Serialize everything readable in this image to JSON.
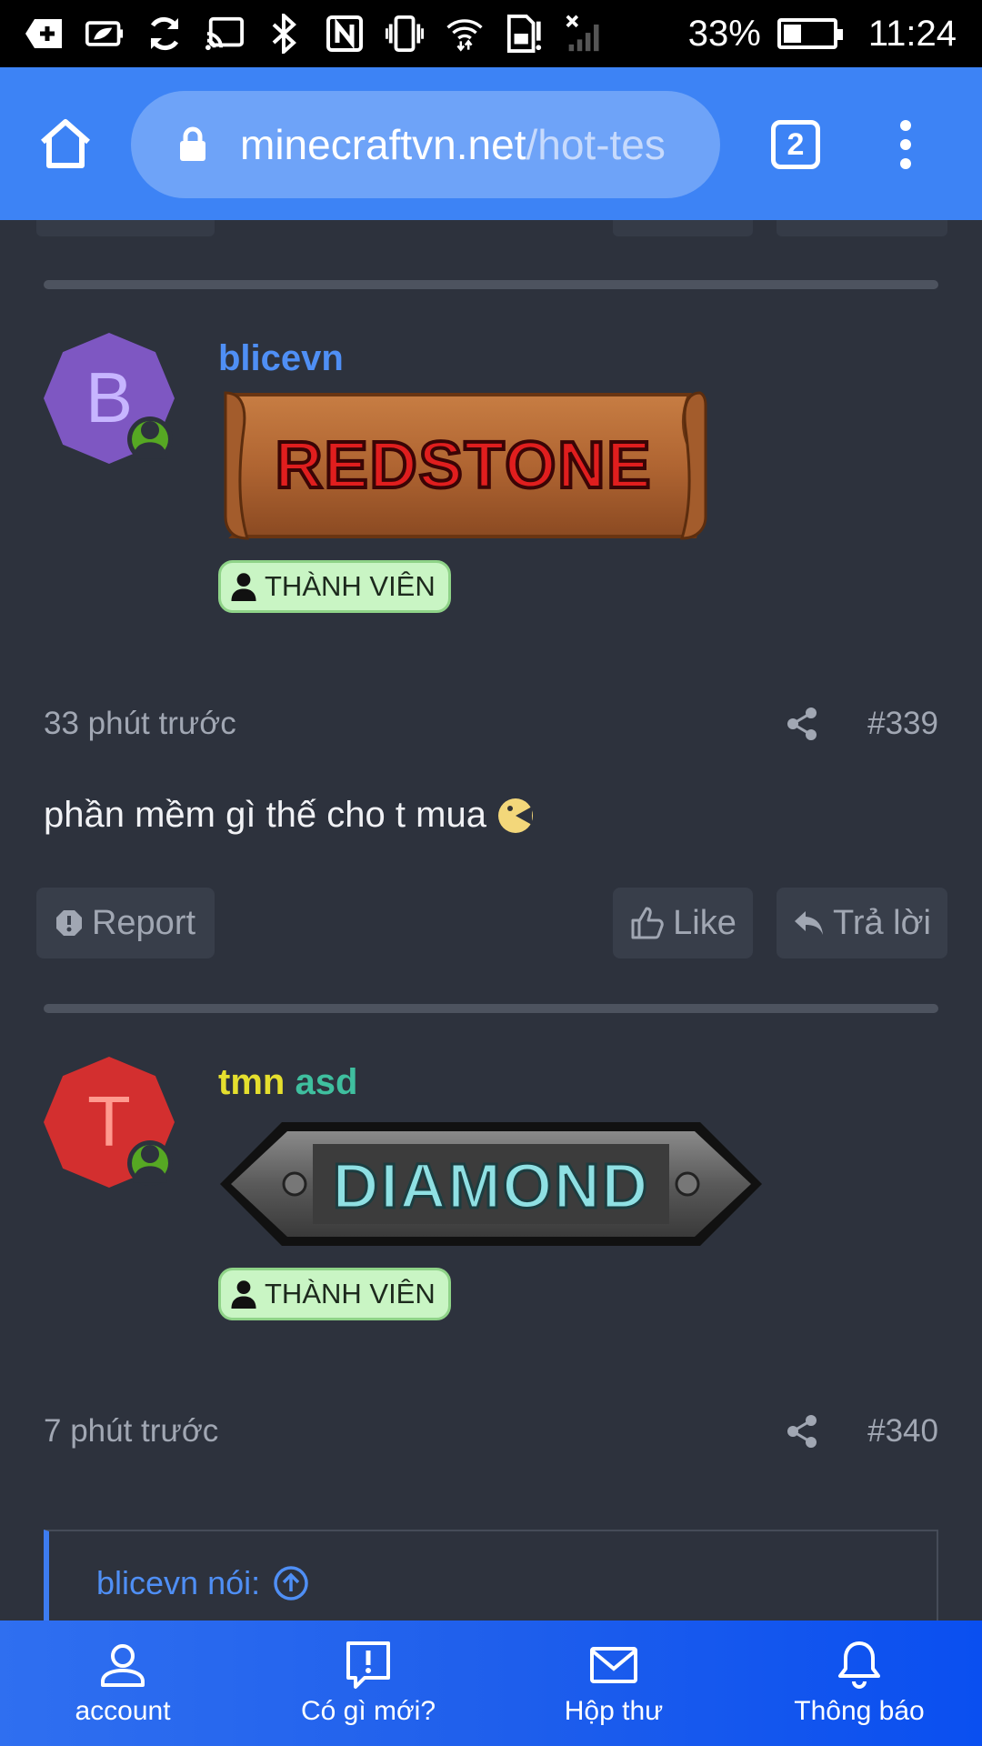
{
  "status_bar": {
    "battery": "33%",
    "time": "11:24",
    "battery_level": 0.33,
    "icons": [
      "add-icon",
      "battery-saver-icon",
      "sync-icon",
      "cast-icon",
      "bluetooth-icon",
      "nfc-icon",
      "vibrate-icon",
      "wifi-icon",
      "sim-alert-icon",
      "no-signal-icon"
    ]
  },
  "browser": {
    "url_host": "minecraftvn.net",
    "url_path": "/hot-tes",
    "tab_count": "2",
    "icons": [
      "home-icon",
      "lock-icon",
      "menu-icon"
    ]
  },
  "posts": [
    {
      "avatar_letter": "B",
      "avatar_color": "#7e57c2",
      "username": "blicevn",
      "username_color": "#4f8ff5",
      "rank_banner": "REDSTONE",
      "role_badge": "THÀNH VIÊN",
      "time": "33 phút trước",
      "number": "#339",
      "text": "phần mềm gì thế cho t mua",
      "actions": {
        "report": "Report",
        "like": "Like",
        "reply": "Trả lời"
      }
    },
    {
      "avatar_letter": "T",
      "avatar_color": "#d32f2f",
      "username_part1": "tmn",
      "username_part2": "asd",
      "username_colors": [
        "#e5df2e",
        "#3fbf9f"
      ],
      "rank_banner": "DIAMOND",
      "role_badge": "THÀNH VIÊN",
      "time": "7 phút trước",
      "number": "#340",
      "quote_author": "blicevn nói:"
    }
  ],
  "bottom_nav": [
    {
      "label": "account",
      "icon": "account-icon"
    },
    {
      "label": "Có gì mới?",
      "icon": "whats-new-icon"
    },
    {
      "label": "Hộp thư",
      "icon": "inbox-icon"
    },
    {
      "label": "Thông báo",
      "icon": "bell-icon"
    }
  ],
  "colors": {
    "toolbar": "#3d83f5",
    "background": "#2d323d",
    "accent": "#4f8ff5",
    "online": "#56a823"
  }
}
